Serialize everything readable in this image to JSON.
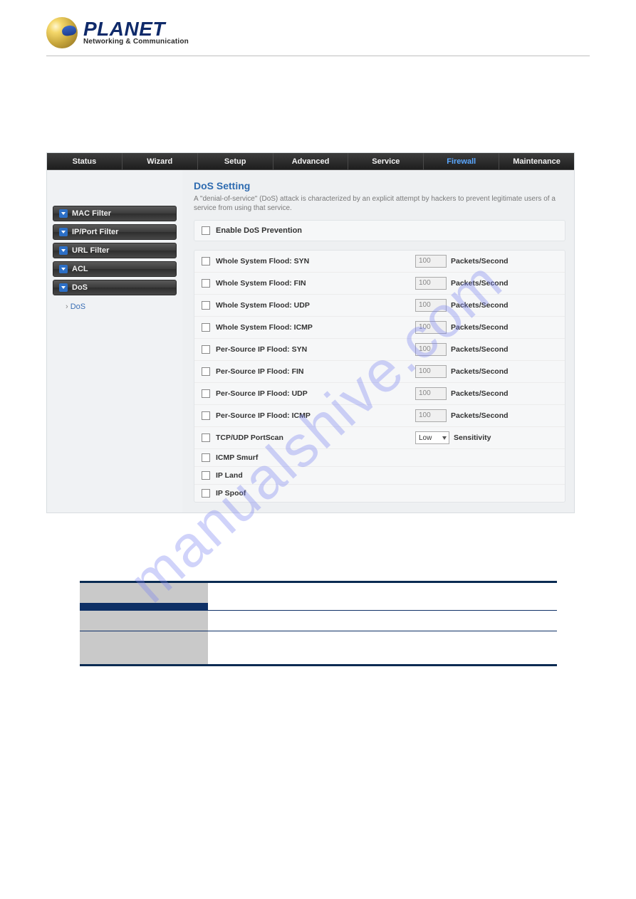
{
  "brand": {
    "name": "PLANET",
    "tagline": "Networking & Communication"
  },
  "watermark": "manualshive.com",
  "nav": {
    "tabs": [
      "Status",
      "Wizard",
      "Setup",
      "Advanced",
      "Service",
      "Firewall",
      "Maintenance"
    ],
    "active": "Firewall"
  },
  "sidebar": {
    "items": [
      {
        "label": "MAC Filter"
      },
      {
        "label": "IP/Port Filter"
      },
      {
        "label": "URL Filter"
      },
      {
        "label": "ACL"
      },
      {
        "label": "DoS"
      }
    ],
    "sub": {
      "label": "DoS"
    }
  },
  "content": {
    "title": "DoS Setting",
    "desc": "A \"denial-of-service\" (DoS) attack is characterized by an explicit attempt by hackers to prevent legitimate users of a service from using that service.",
    "enable_label": "Enable DoS Prevention",
    "rows": [
      {
        "label": "Whole System Flood: SYN",
        "type": "num",
        "value": "100",
        "unit": "Packets/Second"
      },
      {
        "label": "Whole System Flood: FIN",
        "type": "num",
        "value": "100",
        "unit": "Packets/Second"
      },
      {
        "label": "Whole System Flood: UDP",
        "type": "num",
        "value": "100",
        "unit": "Packets/Second"
      },
      {
        "label": "Whole System Flood: ICMP",
        "type": "num",
        "value": "100",
        "unit": "Packets/Second"
      },
      {
        "label": "Per-Source IP Flood: SYN",
        "type": "num",
        "value": "100",
        "unit": "Packets/Second"
      },
      {
        "label": "Per-Source IP Flood: FIN",
        "type": "num",
        "value": "100",
        "unit": "Packets/Second"
      },
      {
        "label": "Per-Source IP Flood: UDP",
        "type": "num",
        "value": "100",
        "unit": "Packets/Second"
      },
      {
        "label": "Per-Source IP Flood: ICMP",
        "type": "num",
        "value": "100",
        "unit": "Packets/Second"
      },
      {
        "label": "TCP/UDP PortScan",
        "type": "select",
        "value": "Low",
        "unit": "Sensitivity"
      },
      {
        "label": "ICMP Smurf",
        "type": "none"
      },
      {
        "label": "IP Land",
        "type": "none"
      },
      {
        "label": "IP Spoof",
        "type": "none"
      }
    ]
  }
}
